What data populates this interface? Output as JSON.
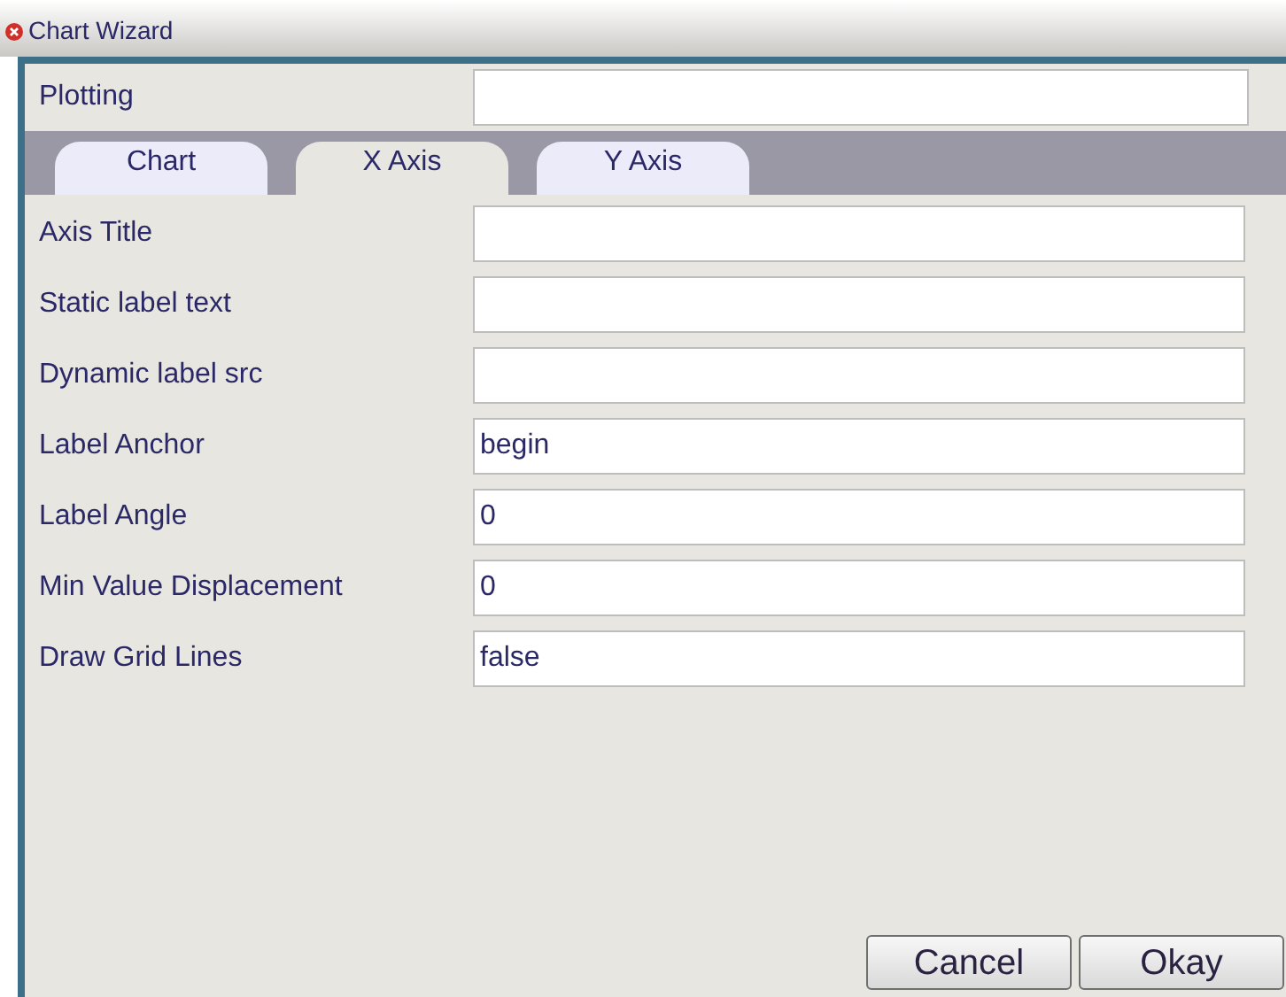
{
  "window": {
    "title": "Chart Wizard"
  },
  "plotting": {
    "label": "Plotting"
  },
  "tabs": [
    {
      "label": "Chart",
      "selected": false
    },
    {
      "label": "X Axis",
      "selected": true
    },
    {
      "label": "Y Axis",
      "selected": false
    }
  ],
  "fields": [
    {
      "label": "Axis Title"
    },
    {
      "label": "Static label text"
    },
    {
      "label": "Dynamic label src"
    },
    {
      "label": "Label Anchor",
      "value": "begin"
    },
    {
      "label": "Label Angle",
      "value": "0"
    },
    {
      "label": "Min Value Displacement",
      "value": "0"
    },
    {
      "label": "Draw Grid Lines",
      "value": "false"
    }
  ],
  "buttons": [
    "Cancel",
    "Okay"
  ]
}
